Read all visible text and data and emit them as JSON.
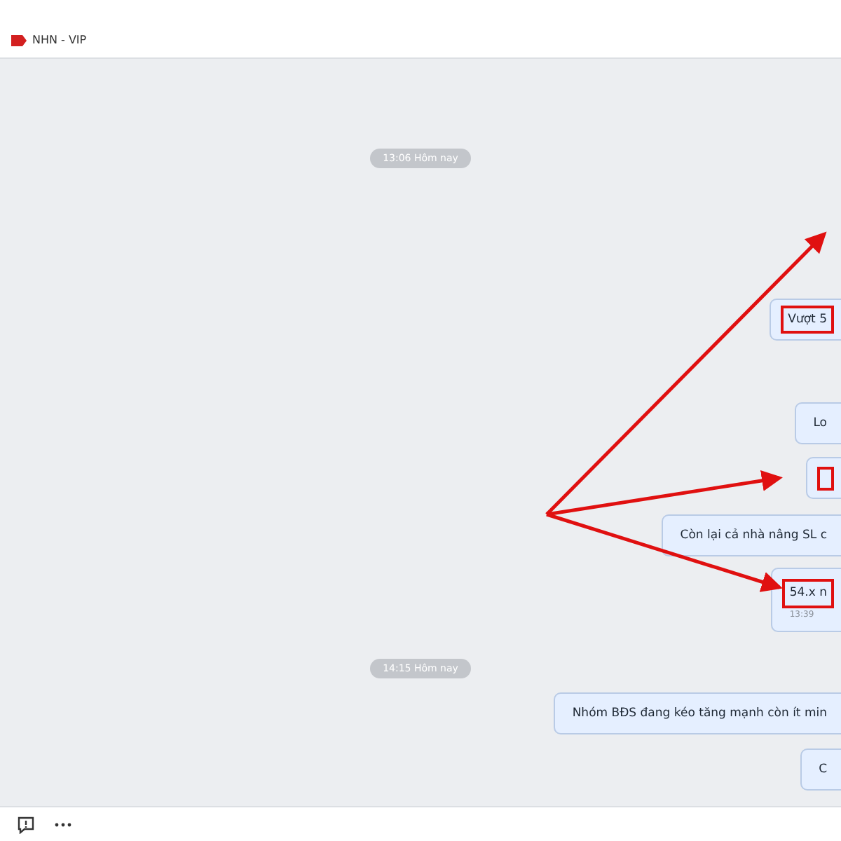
{
  "header": {
    "title": "NHN - VIP"
  },
  "messages": [
    {
      "kind": "time",
      "text": "13:06 Hôm nay"
    },
    {
      "kind": "bubble",
      "text": "Vượt 5",
      "highlighted": true
    },
    {
      "kind": "bubble",
      "text": "Lo",
      "highlighted": false
    },
    {
      "kind": "bubble",
      "highlighted": true
    },
    {
      "kind": "bubble",
      "text": "Còn lại cả nhà nâng SL c",
      "highlighted": false
    },
    {
      "kind": "bubble",
      "text": "54.x n",
      "time": "13:39",
      "highlighted": true
    },
    {
      "kind": "time",
      "text": "14:15 Hôm nay"
    },
    {
      "kind": "bubble",
      "text": "Nhóm BĐS đang kéo tăng mạnh còn ít min",
      "highlighted": false
    },
    {
      "kind": "bubble",
      "text": "C",
      "highlighted": false
    }
  ]
}
